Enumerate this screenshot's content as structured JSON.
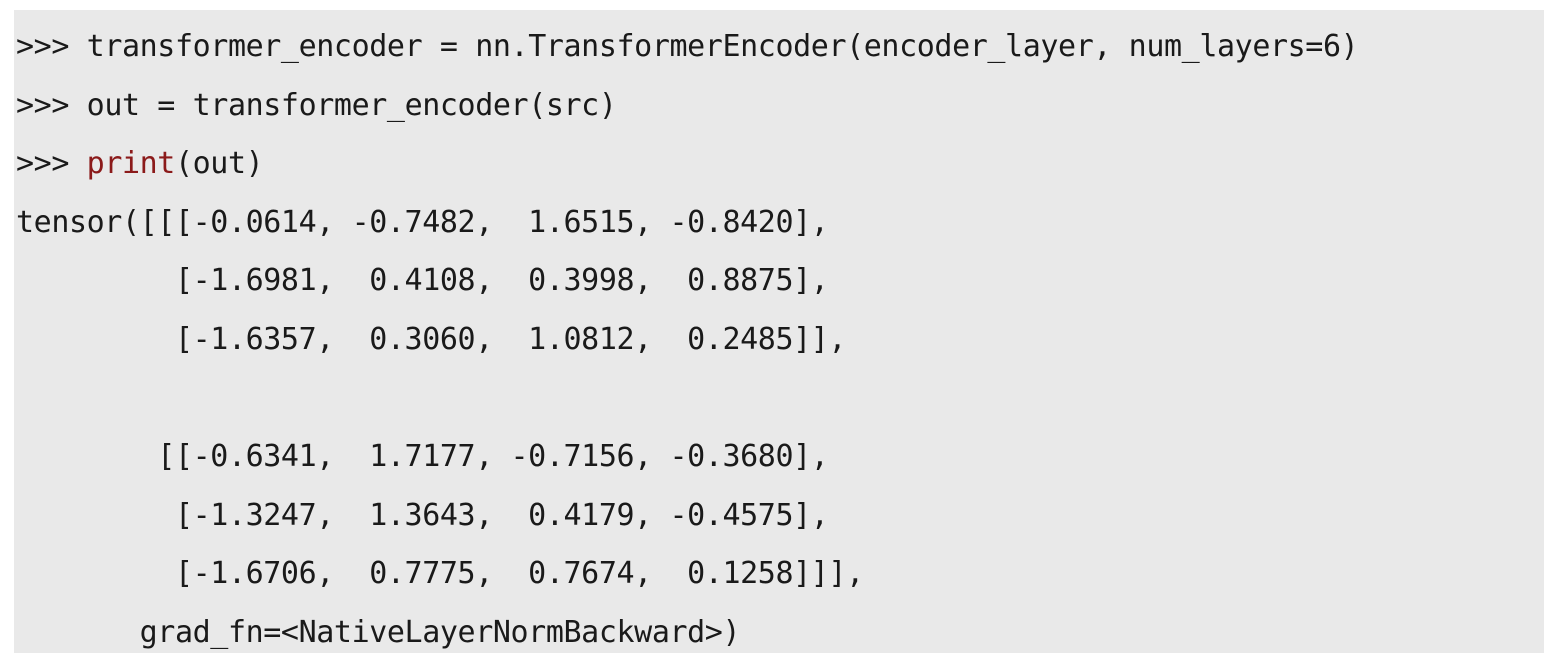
{
  "code": {
    "prompt": ">>> ",
    "line1_text": "transformer_encoder = nn.TransformerEncoder(encoder_layer, num_layers=6)",
    "line2_text": "out = transformer_encoder(src)",
    "line3_builtin": "print",
    "line3_rest": "(out)",
    "output_lines": [
      "tensor([[[-0.0614, -0.7482,  1.6515, -0.8420],",
      "         [-1.6981,  0.4108,  0.3998,  0.8875],",
      "         [-1.6357,  0.3060,  1.0812,  0.2485]],",
      "",
      "        [[-0.6341,  1.7177, -0.7156, -0.3680],",
      "         [-1.3247,  1.3643,  0.4179, -0.4575],",
      "         [-1.6706,  0.7775,  0.7674,  0.1258]]],",
      "       grad_fn=<NativeLayerNormBackward>)"
    ]
  },
  "colors": {
    "background": "#e9e9e9",
    "text": "#1a1a1a",
    "builtin_keyword": "#8b1a1a"
  }
}
